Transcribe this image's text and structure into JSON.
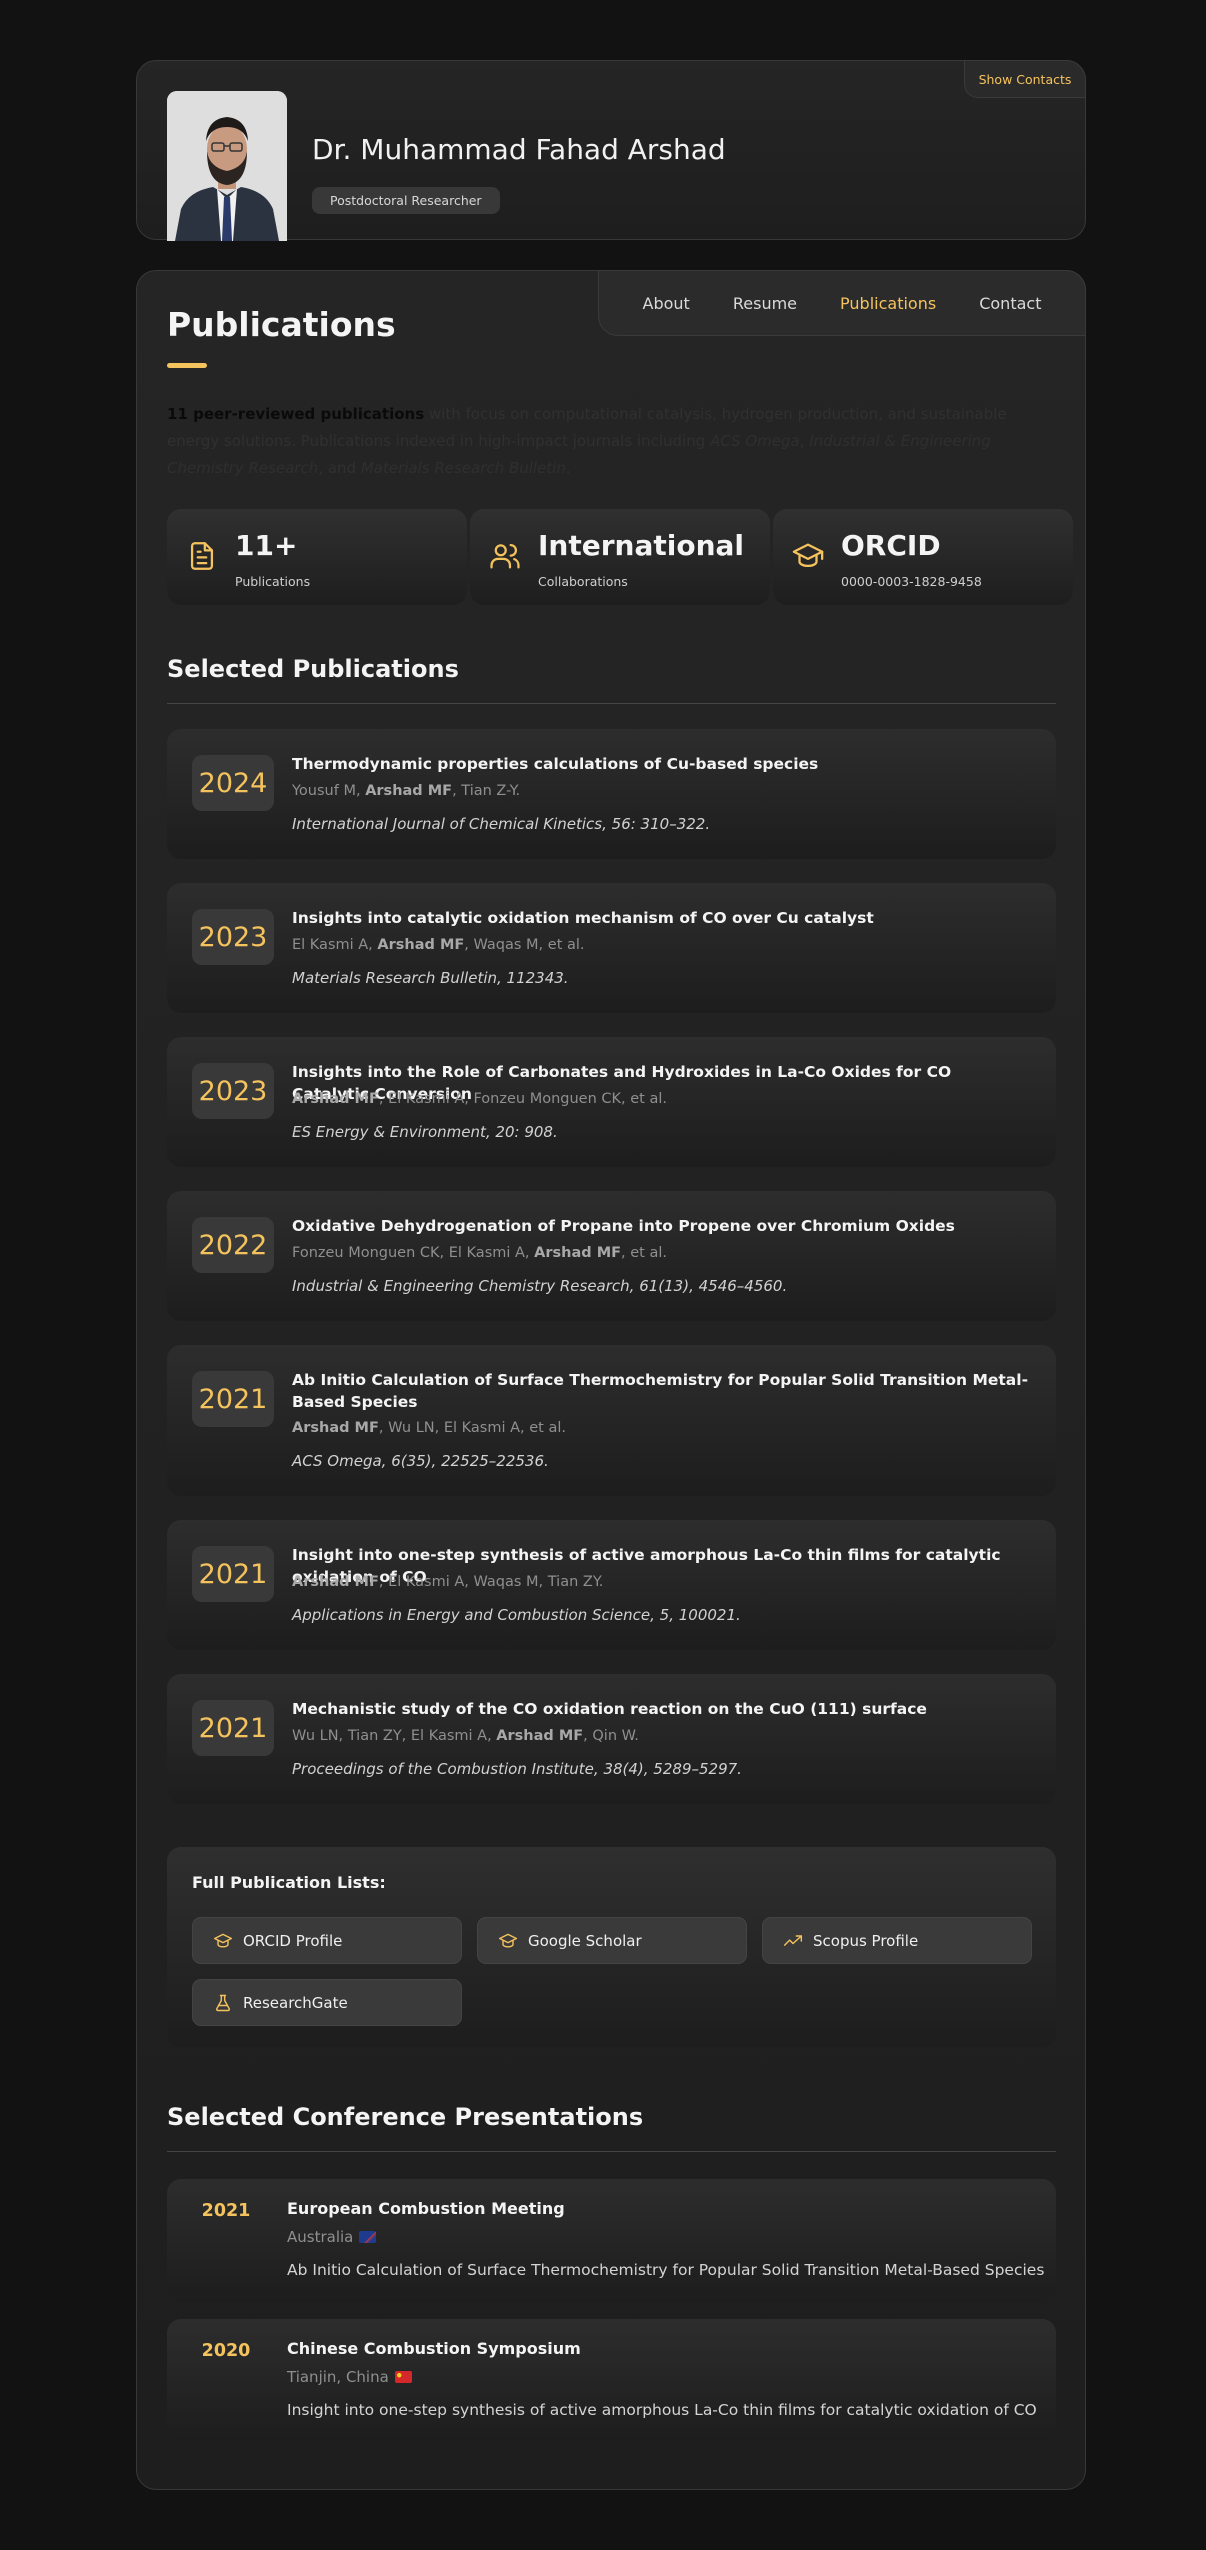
{
  "header": {
    "contacts_button": "Show Contacts",
    "name": "Dr. Muhammad Fahad Arshad",
    "role": "Postdoctoral Researcher"
  },
  "nav": {
    "items": [
      "About",
      "Resume",
      "Publications",
      "Contact"
    ],
    "active": "Publications"
  },
  "page": {
    "title": "Publications",
    "intro_bold": "11 peer-reviewed publications",
    "intro_text": " with focus on computational catalysis, hydrogen production, and sustainable energy solutions. Publications indexed in high-impact journals including ",
    "intro_journals_1": "ACS Omega",
    "intro_sep_1": ", ",
    "intro_journals_2": "Industrial & Engineering Chemistry Research",
    "intro_sep_2": ", and ",
    "intro_journals_3": "Materials Research Bulletin",
    "intro_end": "."
  },
  "stats": [
    {
      "icon": "document-icon",
      "value": "11+",
      "label": "Publications"
    },
    {
      "icon": "users-icon",
      "value": "International",
      "label": "Collaborations"
    },
    {
      "icon": "graduation-cap-icon",
      "value": "ORCID",
      "label": "0000-0003-1828-9458"
    }
  ],
  "selected_publications": {
    "title": "Selected Publications",
    "items": [
      {
        "year": "2024",
        "title": "Thermodynamic properties calculations of Cu-based species",
        "authors_before": "Yousuf M, ",
        "authors_bold": "Arshad MF",
        "authors_after": ", Tian Z-Y.",
        "journal": "International Journal of Chemical Kinetics, 56: 310–322."
      },
      {
        "year": "2023",
        "title": "Insights into catalytic oxidation mechanism of CO over Cu catalyst",
        "authors_before": "El Kasmi A, ",
        "authors_bold": "Arshad MF",
        "authors_after": ", Waqas M, et al.",
        "journal": "Materials Research Bulletin, 112343."
      },
      {
        "year": "2023",
        "title": "Insights into the Role of Carbonates and Hydroxides in La-Co Oxides for CO Catalytic Conversion",
        "authors_before": "",
        "authors_bold": "Arshad MF",
        "authors_after": ", El Kasmi A, Fonzeu Monguen CK, et al.",
        "journal": "ES Energy & Environment, 20: 908."
      },
      {
        "year": "2022",
        "title": "Oxidative Dehydrogenation of Propane into Propene over Chromium Oxides",
        "authors_before": "Fonzeu Monguen CK, El Kasmi A, ",
        "authors_bold": "Arshad MF",
        "authors_after": ", et al.",
        "journal": "Industrial & Engineering Chemistry Research, 61(13), 4546–4560."
      },
      {
        "year": "2021",
        "title": "Ab Initio Calculation of Surface Thermochemistry for Popular Solid Transition Metal-Based Species",
        "authors_before": "",
        "authors_bold": "Arshad MF",
        "authors_after": ", Wu LN, El Kasmi A, et al.",
        "journal": "ACS Omega, 6(35), 22525–22536."
      },
      {
        "year": "2021",
        "title": "Insight into one-step synthesis of active amorphous La-Co thin films for catalytic oxidation of CO",
        "authors_before": "",
        "authors_bold": "Arshad MF",
        "authors_after": ", El Kasmi A, Waqas M, Tian ZY.",
        "journal": "Applications in Energy and Combustion Science, 5, 100021."
      },
      {
        "year": "2021",
        "title": "Mechanistic study of the CO oxidation reaction on the CuO (111) surface",
        "authors_before": "Wu LN, Tian ZY, El Kasmi A, ",
        "authors_bold": "Arshad MF",
        "authors_after": ", Qin W.",
        "journal": "Proceedings of the Combustion Institute, 38(4), 5289–5297."
      }
    ]
  },
  "full_lists": {
    "title": "Full Publication Lists:",
    "buttons": [
      {
        "label": "ORCID Profile",
        "icon": "graduation-cap-icon"
      },
      {
        "label": "Google Scholar",
        "icon": "graduation-cap-icon"
      },
      {
        "label": "Scopus Profile",
        "icon": "trend-line-icon"
      },
      {
        "label": "ResearchGate",
        "icon": "flask-icon"
      }
    ]
  },
  "conferences": {
    "title": "Selected Conference Presentations",
    "items": [
      {
        "year": "2021",
        "name": "European Combustion Meeting",
        "location": "Australia",
        "flag": "australia-flag-icon",
        "talk": "Ab Initio Calculation of Surface Thermochemistry for Popular Solid Transition Metal-Based Species"
      },
      {
        "year": "2020",
        "name": "Chinese Combustion Symposium",
        "location": "Tianjin, China",
        "flag": "china-flag-icon",
        "talk": "Insight into one-step synthesis of active amorphous La-Co thin films for catalytic oxidation of CO"
      }
    ]
  },
  "colors": {
    "background": "#121212",
    "card": "#222222",
    "accent": "#f5c35d",
    "text": "#f4f4f4",
    "muted": "#8f8f8f"
  }
}
